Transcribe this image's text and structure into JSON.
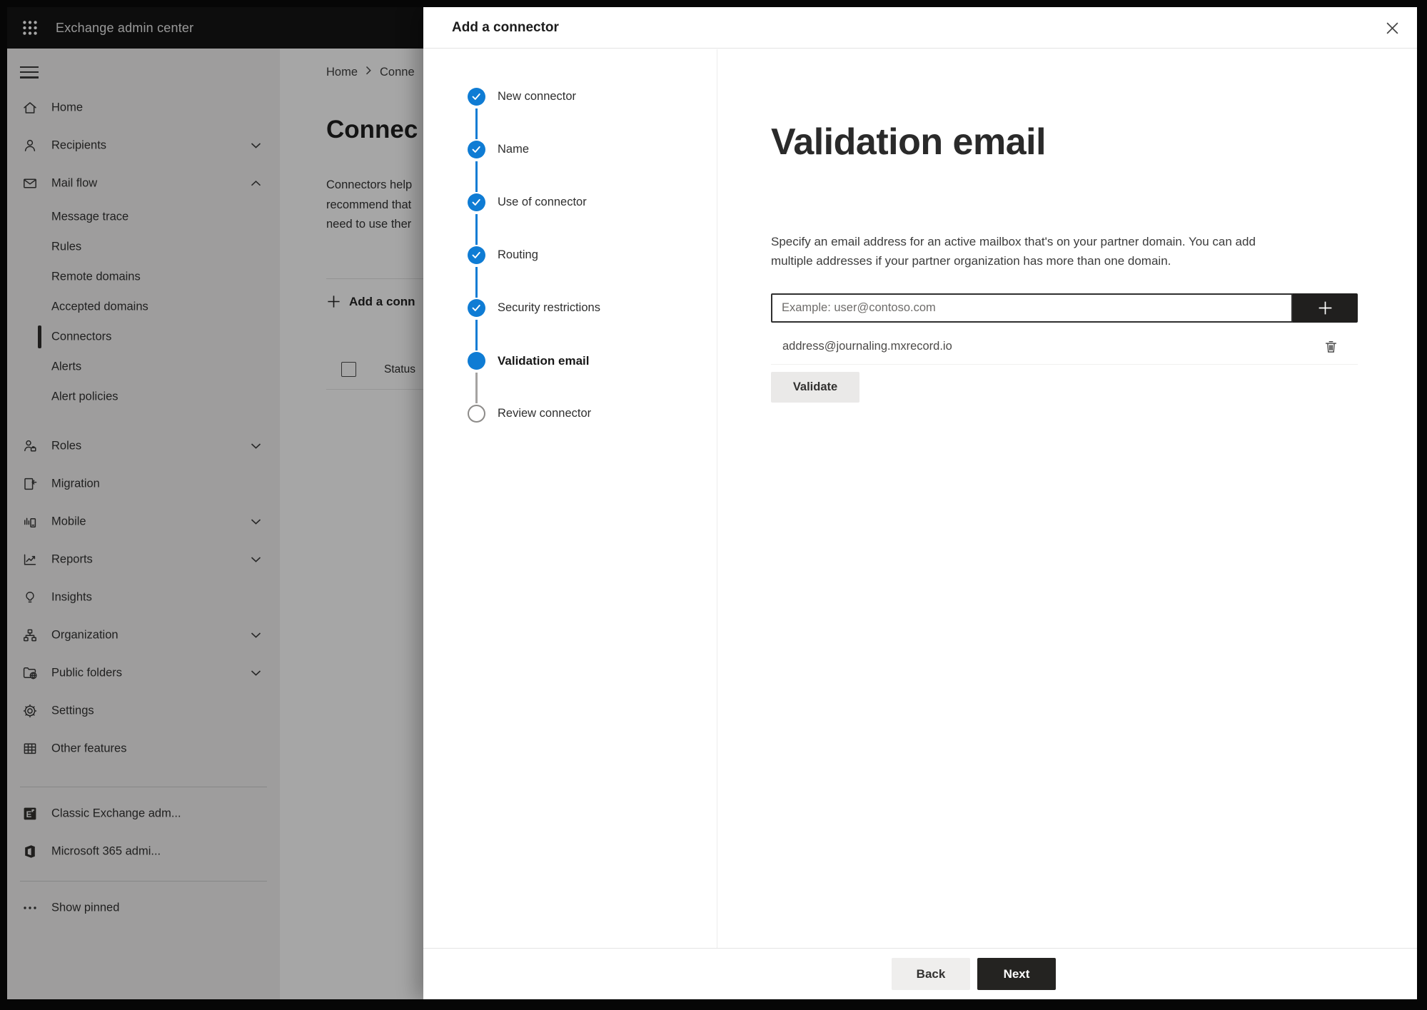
{
  "topbar": {
    "title": "Exchange admin center"
  },
  "sidebar": {
    "items": [
      {
        "label": "Home",
        "icon": "home-icon"
      },
      {
        "label": "Recipients",
        "icon": "person-icon",
        "chevron": "down"
      },
      {
        "label": "Mail flow",
        "icon": "mail-icon",
        "chevron": "up",
        "expanded": true
      },
      {
        "label": "Message trace",
        "sub": true
      },
      {
        "label": "Rules",
        "sub": true
      },
      {
        "label": "Remote domains",
        "sub": true
      },
      {
        "label": "Accepted domains",
        "sub": true
      },
      {
        "label": "Connectors",
        "sub": true,
        "selected": true
      },
      {
        "label": "Alerts",
        "sub": true
      },
      {
        "label": "Alert policies",
        "sub": true
      },
      {
        "label": "Roles",
        "icon": "roles-icon",
        "chevron": "down"
      },
      {
        "label": "Migration",
        "icon": "migration-icon"
      },
      {
        "label": "Mobile",
        "icon": "mobile-icon",
        "chevron": "down"
      },
      {
        "label": "Reports",
        "icon": "reports-icon",
        "chevron": "down"
      },
      {
        "label": "Insights",
        "icon": "insights-icon"
      },
      {
        "label": "Organization",
        "icon": "organization-icon",
        "chevron": "down"
      },
      {
        "label": "Public folders",
        "icon": "public-folders-icon",
        "chevron": "down"
      },
      {
        "label": "Settings",
        "icon": "settings-icon"
      },
      {
        "label": "Other features",
        "icon": "other-features-icon"
      },
      {
        "label": "Classic Exchange adm...",
        "icon": "classic-exchange-icon"
      },
      {
        "label": "Microsoft 365 admi...",
        "icon": "microsoft-365-icon"
      },
      {
        "label": "Show pinned",
        "icon": "ellipsis-icon"
      }
    ]
  },
  "page": {
    "breadcrumb": [
      "Home",
      "Conne"
    ],
    "title": "Connec",
    "body_lines": [
      "Connectors help",
      "recommend that",
      "need to use ther"
    ],
    "add_button": "Add a conn",
    "table_header": "Status"
  },
  "modal": {
    "title": "Add a connector",
    "steps": [
      {
        "label": "New connector",
        "state": "completed"
      },
      {
        "label": "Name",
        "state": "completed"
      },
      {
        "label": "Use of connector",
        "state": "completed"
      },
      {
        "label": "Routing",
        "state": "completed"
      },
      {
        "label": "Security restrictions",
        "state": "completed"
      },
      {
        "label": "Validation email",
        "state": "current"
      },
      {
        "label": "Review connector",
        "state": "upcoming"
      }
    ],
    "heading": "Validation email",
    "description_lines": [
      "Specify an email address for an active mailbox that's on your partner domain. You can add",
      "multiple addresses if your partner organization has more than one domain."
    ],
    "email_input": {
      "value": "",
      "placeholder": "Example: user@contoso.com"
    },
    "addresses": [
      "address@journaling.mxrecord.io"
    ],
    "validate_label": "Validate",
    "back_label": "Back",
    "next_label": "Next"
  },
  "colors": {
    "accent": "#0f7cd4",
    "topbar": "#151515",
    "next_button": "#242321",
    "overlay": "rgba(0,0,0,0.35)"
  }
}
